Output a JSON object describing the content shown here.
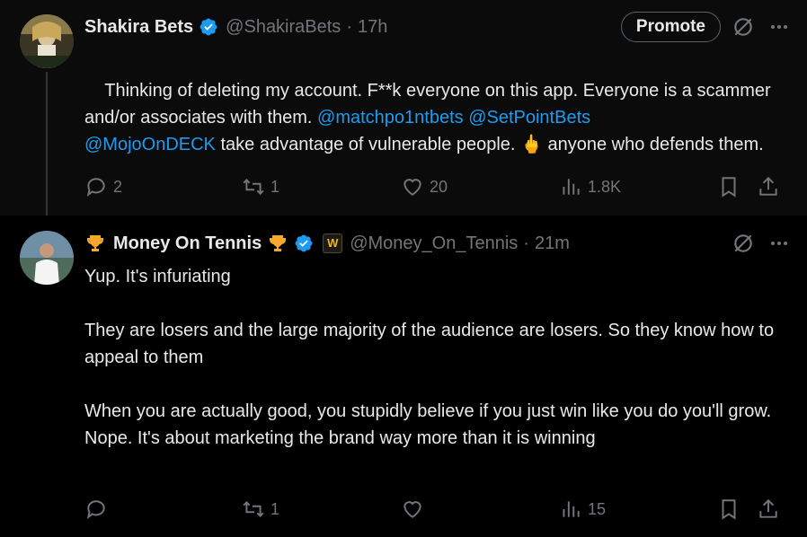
{
  "tweets": [
    {
      "name": "Shakira Bets",
      "handle": "@ShakiraBets",
      "dot": "·",
      "time": "17h",
      "promote_label": "Promote",
      "text_before": "Thinking of deleting my account. F**k everyone on this app. Everyone is a scammer and/or associates with them. ",
      "mention_1": "@matchpo1ntbets",
      "mention_2": "@SetPointBets",
      "mention_3": "@MojoOnDECK",
      "text_mid": " take advantage of vulnerable people. ",
      "emoji": "🖕",
      "text_after": " anyone who defends them.",
      "replies": "2",
      "reposts": "1",
      "likes": "20",
      "views": "1.8K"
    },
    {
      "name": "Money On Tennis",
      "handle": "@Money_On_Tennis",
      "dot": "·",
      "time": "21m",
      "badge_letter": "W",
      "text": "Yup. It's infuriating\n\nThey are losers and the large majority of the audience are losers. So they know how to appeal to them\n\nWhen you are actually good, you stupidly believe if you just win like you do you'll grow. Nope. It's about marketing the brand way more than it is winning",
      "replies": "",
      "reposts": "1",
      "likes": "",
      "views": "15"
    }
  ],
  "colors": {
    "background": "#000000",
    "text": "#e7e9ea",
    "muted": "#71767b",
    "link": "#1d9bf0",
    "verified": "#1d9bf0"
  },
  "icons": [
    "verified-icon",
    "trophy-icon",
    "grok-icon",
    "more-icon",
    "reply-icon",
    "repost-icon",
    "like-icon",
    "views-icon",
    "bookmark-icon",
    "share-icon"
  ]
}
